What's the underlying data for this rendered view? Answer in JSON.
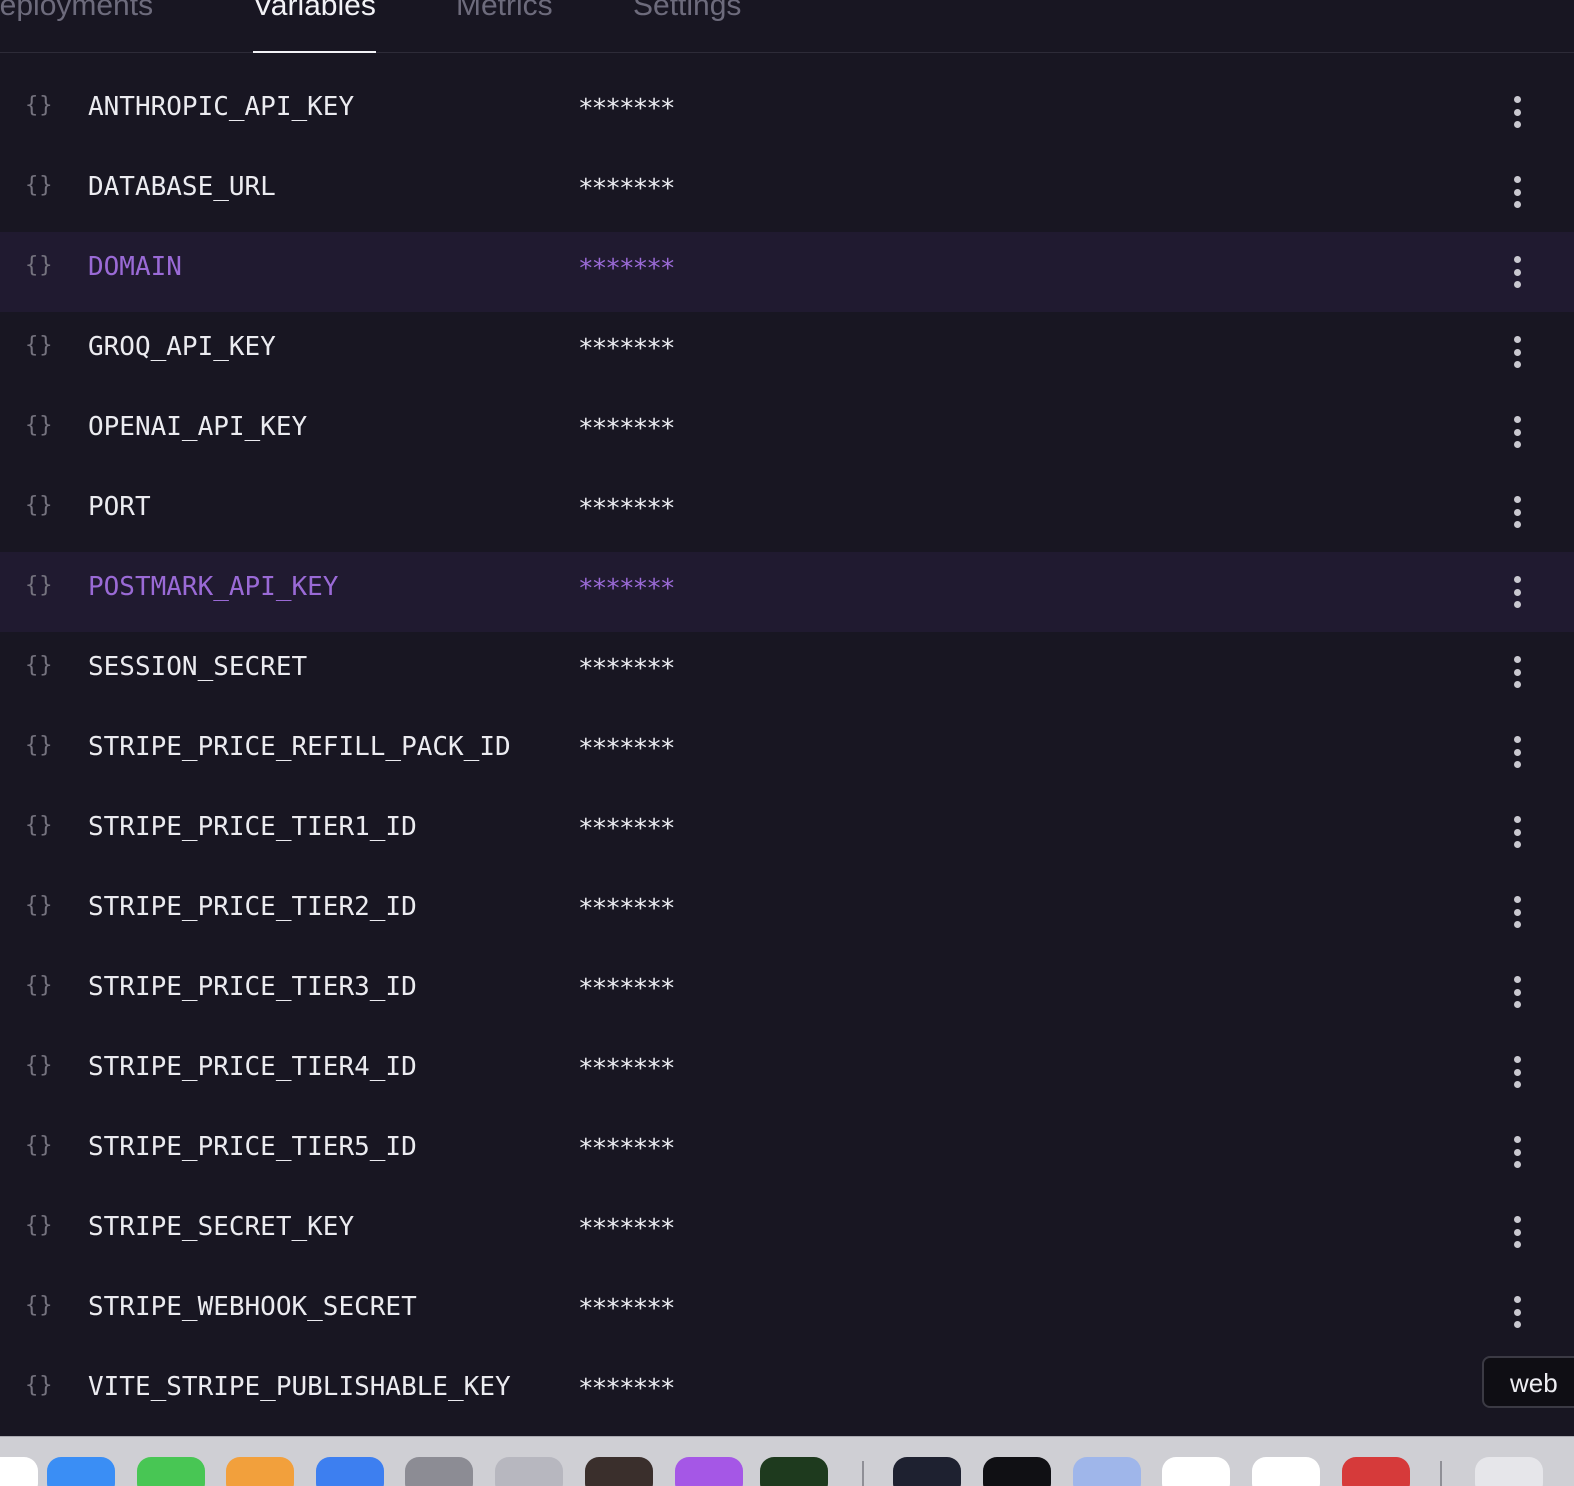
{
  "tabs": [
    {
      "label": "Deployments",
      "active": false
    },
    {
      "label": "Variables",
      "active": true
    },
    {
      "label": "Metrics",
      "active": false
    },
    {
      "label": "Settings",
      "active": false
    }
  ],
  "variables": [
    {
      "name": "ANTHROPIC_API_KEY",
      "value": "*******",
      "highlighted": false
    },
    {
      "name": "DATABASE_URL",
      "value": "*******",
      "highlighted": false
    },
    {
      "name": "DOMAIN",
      "value": "*******",
      "highlighted": true
    },
    {
      "name": "GROQ_API_KEY",
      "value": "*******",
      "highlighted": false
    },
    {
      "name": "OPENAI_API_KEY",
      "value": "*******",
      "highlighted": false
    },
    {
      "name": "PORT",
      "value": "*******",
      "highlighted": false
    },
    {
      "name": "POSTMARK_API_KEY",
      "value": "*******",
      "highlighted": true
    },
    {
      "name": "SESSION_SECRET",
      "value": "*******",
      "highlighted": false
    },
    {
      "name": "STRIPE_PRICE_REFILL_PACK_ID",
      "value": "*******",
      "highlighted": false
    },
    {
      "name": "STRIPE_PRICE_TIER1_ID",
      "value": "*******",
      "highlighted": false
    },
    {
      "name": "STRIPE_PRICE_TIER2_ID",
      "value": "*******",
      "highlighted": false
    },
    {
      "name": "STRIPE_PRICE_TIER3_ID",
      "value": "*******",
      "highlighted": false
    },
    {
      "name": "STRIPE_PRICE_TIER4_ID",
      "value": "*******",
      "highlighted": false
    },
    {
      "name": "STRIPE_PRICE_TIER5_ID",
      "value": "*******",
      "highlighted": false
    },
    {
      "name": "STRIPE_SECRET_KEY",
      "value": "*******",
      "highlighted": false
    },
    {
      "name": "STRIPE_WEBHOOK_SECRET",
      "value": "*******",
      "highlighted": false
    },
    {
      "name": "VITE_STRIPE_PUBLISHABLE_KEY",
      "value": "*******",
      "highlighted": false
    }
  ],
  "variable_icon": "braces-icon",
  "row_menu_icon": "more-vertical-icon",
  "tooltip": {
    "label": "web"
  },
  "dock": {
    "icons": [
      {
        "name": "finder-icon",
        "color": "#ffffff"
      },
      {
        "name": "photos-icon",
        "color": "#3a8ef5"
      },
      {
        "name": "numbers-icon",
        "color": "#48c654"
      },
      {
        "name": "pages-icon",
        "color": "#f2a03c"
      },
      {
        "name": "xcode-icon",
        "color": "#3d7ff0"
      },
      {
        "name": "system-settings-icon",
        "color": "#8c8c94"
      },
      {
        "name": "iphone-mirroring-icon",
        "color": "#b7b7bf"
      },
      {
        "name": "photo-booth-icon",
        "color": "#3a2f2c"
      },
      {
        "name": "podcasts-icon",
        "color": "#a557e6"
      },
      {
        "name": "globe-app-icon",
        "color": "#1e3a1e"
      },
      {
        "name": "app-icon",
        "color": "#1e2130"
      },
      {
        "name": "terminal-icon",
        "color": "#101014"
      },
      {
        "name": "preview-icon",
        "color": "#9fb6ea"
      },
      {
        "name": "chatgpt-icon",
        "color": "#ffffff"
      },
      {
        "name": "network-app-icon",
        "color": "#ffffff"
      },
      {
        "name": "acrobat-icon",
        "color": "#d63a3a"
      },
      {
        "name": "documents-icon",
        "color": "#e6e6ea"
      }
    ]
  },
  "colors": {
    "background": "#181622",
    "highlight_row": "#201a30",
    "highlight_text": "#9a6ad6",
    "text": "#ebebf0"
  }
}
